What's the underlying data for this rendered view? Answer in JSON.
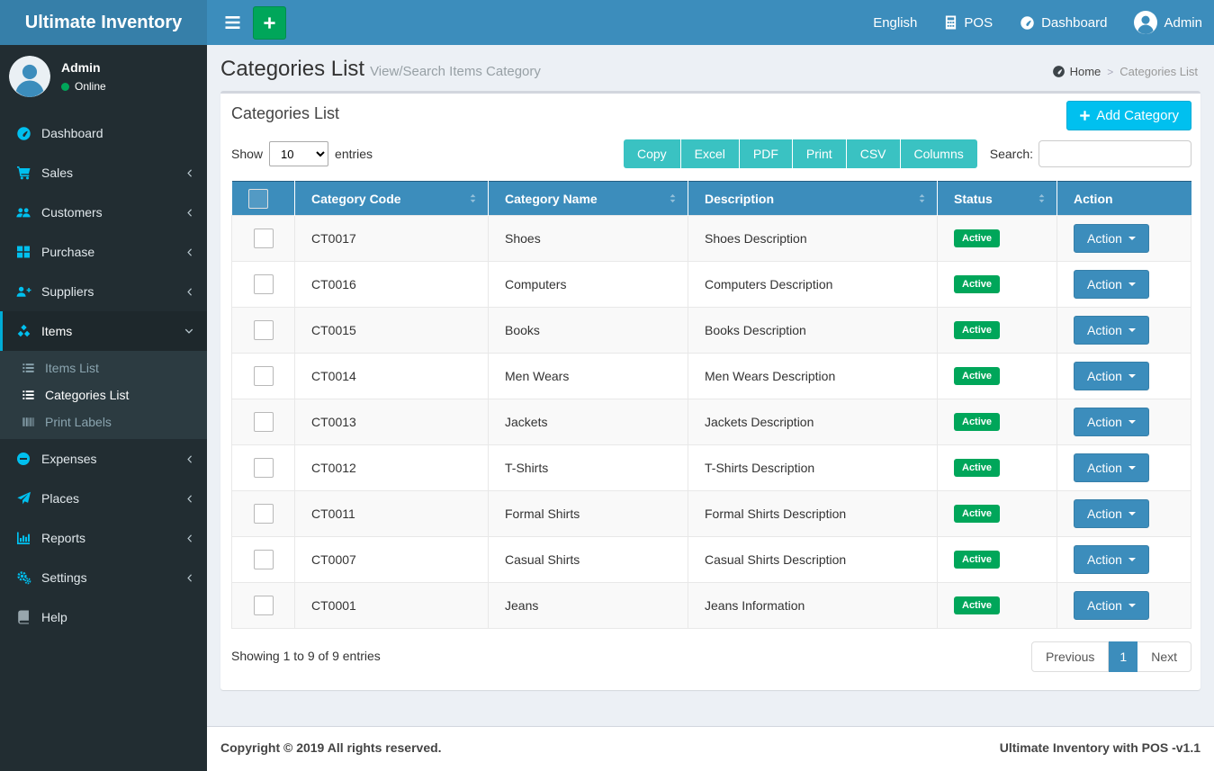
{
  "colors": {
    "navbar_blue": "#3c8dbc",
    "logo_blue": "#367fa9",
    "sidebar_dark": "#222d32",
    "submenu_dark": "#2c3b41",
    "icon_cyan": "#00c0ef",
    "export_teal": "#3ac2c2",
    "badge_green": "#00a65a",
    "add_button_cyan": "#00c0ef",
    "stripe_gray": "#f9f9f9"
  },
  "navbar": {
    "brand": "Ultimate Inventory",
    "menu": {
      "english": "English",
      "pos": "POS",
      "dashboard": "Dashboard",
      "admin": "Admin"
    },
    "icons": [
      "menu-icon",
      "plus-icon",
      "calculator-icon",
      "gauge-icon",
      "avatar"
    ]
  },
  "sidebar": {
    "user": {
      "name": "Admin",
      "status": "Online"
    },
    "items": [
      {
        "label": "Dashboard",
        "icon": "gauge-icon",
        "expandable": false,
        "active": false
      },
      {
        "label": "Sales",
        "icon": "cart-icon",
        "expandable": true,
        "active": false
      },
      {
        "label": "Customers",
        "icon": "users-icon",
        "expandable": true,
        "active": false
      },
      {
        "label": "Purchase",
        "icon": "grid-icon",
        "expandable": true,
        "active": false
      },
      {
        "label": "Suppliers",
        "icon": "user-plus-icon",
        "expandable": true,
        "active": false
      },
      {
        "label": "Items",
        "icon": "cubes-icon",
        "expandable": true,
        "active": true,
        "expanded": true
      },
      {
        "label": "Expenses",
        "icon": "minus-circle-icon",
        "expandable": true,
        "active": false
      },
      {
        "label": "Places",
        "icon": "paper-plane-icon",
        "expandable": true,
        "active": false
      },
      {
        "label": "Reports",
        "icon": "bar-chart-icon",
        "expandable": true,
        "active": false
      },
      {
        "label": "Settings",
        "icon": "gears-icon",
        "expandable": true,
        "active": false
      },
      {
        "label": "Help",
        "icon": "book-icon",
        "expandable": false,
        "active": false
      }
    ],
    "submenu": [
      {
        "label": "Items List",
        "icon": "list-icon",
        "active": false
      },
      {
        "label": "Categories List",
        "icon": "list-icon",
        "active": true
      },
      {
        "label": "Print Labels",
        "icon": "barcode-icon",
        "active": false
      }
    ]
  },
  "page": {
    "title": "Categories List",
    "subtitle": "View/Search Items Category",
    "breadcrumb": {
      "home": "Home",
      "separator": ">",
      "current": "Categories List"
    }
  },
  "card": {
    "title": "Categories List",
    "add_button_label": "Add Category"
  },
  "toolbar": {
    "show_label": "Show",
    "entries_label": "entries",
    "page_length": "10",
    "export_buttons": [
      "Copy",
      "Excel",
      "PDF",
      "Print",
      "CSV",
      "Columns"
    ],
    "search_label": "Search:",
    "search_value": ""
  },
  "table": {
    "headers": [
      "Category Code",
      "Category Name",
      "Description",
      "Status",
      "Action"
    ],
    "rows": [
      {
        "code": "CT0017",
        "name": "Shoes",
        "description": "Shoes Description",
        "status": "Active",
        "action": "Action"
      },
      {
        "code": "CT0016",
        "name": "Computers",
        "description": "Computers Description",
        "status": "Active",
        "action": "Action"
      },
      {
        "code": "CT0015",
        "name": "Books",
        "description": "Books Description",
        "status": "Active",
        "action": "Action"
      },
      {
        "code": "CT0014",
        "name": "Men Wears",
        "description": "Men Wears Description",
        "status": "Active",
        "action": "Action"
      },
      {
        "code": "CT0013",
        "name": "Jackets",
        "description": "Jackets Description",
        "status": "Active",
        "action": "Action"
      },
      {
        "code": "CT0012",
        "name": "T-Shirts",
        "description": "T-Shirts Description",
        "status": "Active",
        "action": "Action"
      },
      {
        "code": "CT0011",
        "name": "Formal Shirts",
        "description": "Formal Shirts Description",
        "status": "Active",
        "action": "Action"
      },
      {
        "code": "CT0007",
        "name": "Casual Shirts",
        "description": "Casual Shirts Description",
        "status": "Active",
        "action": "Action"
      },
      {
        "code": "CT0001",
        "name": "Jeans",
        "description": "Jeans Information",
        "status": "Active",
        "action": "Action"
      }
    ],
    "info": "Showing 1 to 9 of 9 entries",
    "pagination": {
      "previous": "Previous",
      "page": "1",
      "next": "Next"
    }
  },
  "footer": {
    "copyright": "Copyright © 2019 All rights reserved.",
    "version": "Ultimate Inventory with POS -v1.1"
  }
}
